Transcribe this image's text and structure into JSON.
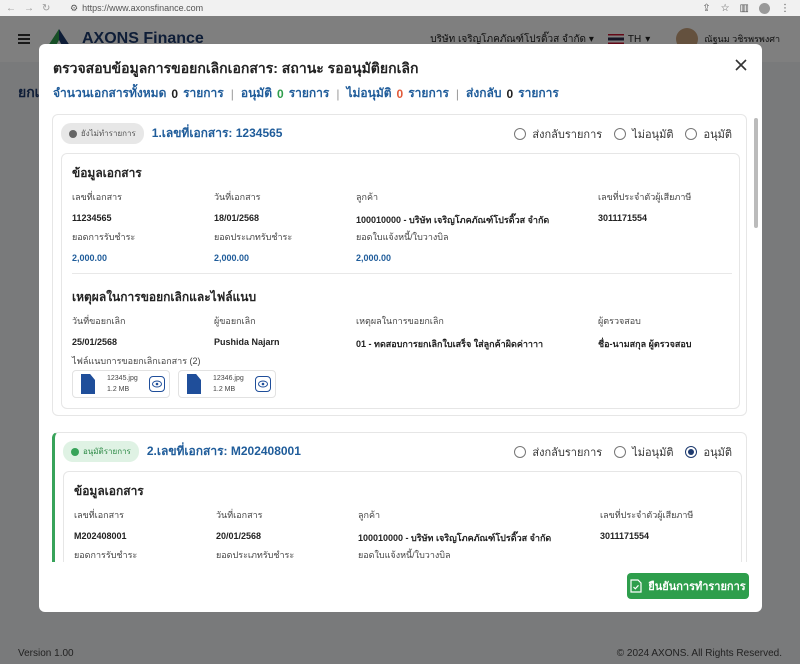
{
  "browser": {
    "url": "https://www.axonsfinance.com"
  },
  "app": {
    "name": "AXONS Finance",
    "company": "บริษัท เจริญโภคภัณฑ์โปรดิ๊วส จำกัด",
    "language": "TH",
    "user_name": "ณัฐนม วชิรพรพงศา",
    "page_title": "ยกเ",
    "footer_version": "Version 1.00",
    "footer_copyright": "© 2024 AXONS. All Rights Reserved."
  },
  "modal": {
    "title": "ตรวจสอบข้อมูลการขอยกเลิกเอกสาร: สถานะ รออนุมัติยกเลิก",
    "summary": {
      "total_label": "จำนวนเอกสารทั้งหมด",
      "total": "0",
      "total_unit": "รายการ",
      "approved_label": "อนุมัติ",
      "approved": "0",
      "approved_unit": "รายการ",
      "rejected_label": "ไม่อนุมัติ",
      "rejected": "0",
      "rejected_unit": "รายการ",
      "returned_label": "ส่งกลับ",
      "returned": "0",
      "returned_unit": "รายการ"
    },
    "radio_labels": {
      "return": "ส่งกลับรายการ",
      "reject": "ไม่อนุมัติ",
      "approve": "อนุมัติ"
    },
    "section_doc_title": "ข้อมูลเอกสาร",
    "section_reason_title": "เหตุผลในการขอยกเลิกและไฟล์แนบ",
    "labels": {
      "doc_no": "เลขที่เอกสาร",
      "doc_date": "วันที่เอกสาร",
      "customer": "ลูกค้า",
      "tax_id": "เลขที่ประจำตัวผู้เสียภาษี",
      "amount_received": "ยอดการรับชำระ",
      "amount_estimated": "ยอดประเภทรับชำระ",
      "amount_invoice": "ยอดใบแจ้งหนี้/ใบวางบิล",
      "cancel_date": "วันที่ขอยกเลิก",
      "requester": "ผู้ขอยกเลิก",
      "reason": "เหตุผลในการขอยกเลิก",
      "reviewer": "ผู้ตรวจสอบ"
    },
    "documents": [
      {
        "status": "ยังไม่ทำรายการ",
        "title": "1.เลขที่เอกสาร: 1234565",
        "selected": "none",
        "doc_no": "11234565",
        "doc_date": "18/01/2568",
        "customer": "100010000 - บริษัท เจริญโภคภัณฑ์โปรดิ๊วส จำกัด",
        "tax_id": "3011171554",
        "amount_received": "2,000.00",
        "amount_estimated": "2,000.00",
        "amount_invoice": "2,000.00",
        "cancel_date": "25/01/2568",
        "requester": "Pushida Najarn",
        "reason": "01 - ทดสอบการยกเลิกใบเสร็จ ใส่ลูกค้าผิดค่าาาา",
        "reviewer": "ชื่อ-นามสกุล ผู้ตรวจสอบ",
        "attachments_label": "ไฟล์แนบการขอยกเลิกเอกสาร (2)",
        "attachments": [
          {
            "name": "12345.jpg",
            "size": "1.2 MB"
          },
          {
            "name": "12346.jpg",
            "size": "1.2 MB"
          }
        ]
      },
      {
        "status": "อนุมัติรายการ",
        "title": "2.เลขที่เอกสาร: M202408001",
        "selected": "approve",
        "doc_no": "M202408001",
        "doc_date": "20/01/2568",
        "customer": "100010000 - บริษัท เจริญโภคภัณฑ์โปรดิ๊วส จำกัด",
        "tax_id": "3011171554"
      }
    ],
    "confirm_button": "ยืนยันการทำรายการ"
  }
}
